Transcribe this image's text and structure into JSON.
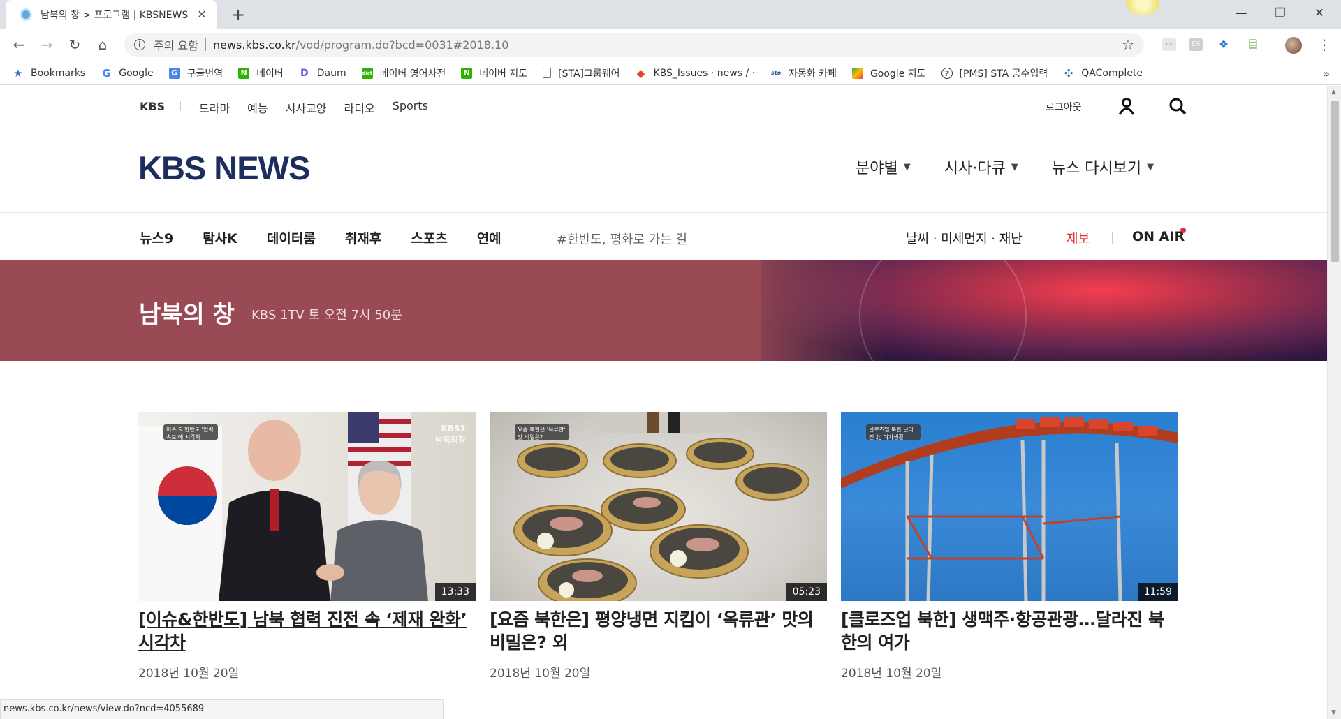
{
  "browser": {
    "tab_title": "남북의 창 > 프로그램 | KBSNEWS",
    "tab_close": "✕",
    "new_tab": "+",
    "window": {
      "minimize": "—",
      "restore": "❐",
      "close": "✕"
    },
    "security_label": "주의 요함",
    "url_host": "news.kbs.co.kr",
    "url_path": "/vod/program.do?bcd=0031#2018.10",
    "bookmarks": [
      {
        "label": "Bookmarks",
        "icon": "star-icon"
      },
      {
        "label": "Google",
        "icon": "google-icon"
      },
      {
        "label": "구글번역",
        "icon": "translate-icon"
      },
      {
        "label": "네이버",
        "icon": "naver-icon"
      },
      {
        "label": "Daum",
        "icon": "daum-icon"
      },
      {
        "label": "네이버 영어사전",
        "icon": "naver-dic-icon"
      },
      {
        "label": "네이버 지도",
        "icon": "naver-map-icon"
      },
      {
        "label": "[STA]그룹웨어",
        "icon": "page-icon"
      },
      {
        "label": "KBS_Issues · news / ·",
        "icon": "gitlab-icon"
      },
      {
        "label": "자동화 카페",
        "icon": "sto-icon"
      },
      {
        "label": "Google 지도",
        "icon": "maps-icon"
      },
      {
        "label": "[PMS] STA 공수입력",
        "icon": "pms-icon"
      },
      {
        "label": "QAComplete",
        "icon": "qa-icon"
      }
    ],
    "bookmarks_more": "»",
    "status_url": "news.kbs.co.kr/news/view.do?ncd=4055689"
  },
  "util": {
    "kbs": "KBS",
    "links": [
      "드라마",
      "예능",
      "시사교양",
      "라디오",
      "Sports"
    ],
    "logout": "로그아웃"
  },
  "header": {
    "logo": "KBS NEWS",
    "menu": [
      "분야별",
      "시사·다큐",
      "뉴스 다시보기"
    ]
  },
  "subnav": {
    "links": [
      "뉴스9",
      "탐사K",
      "데이터룸",
      "취재후",
      "스포츠",
      "연예"
    ],
    "hashtag": "#한반도, 평화로 가는 길",
    "weather": "날씨 · 미세먼지 · 재난",
    "report": "제보",
    "onair": "ON AIR"
  },
  "program": {
    "title": "남북의 창",
    "schedule": "KBS 1TV 토 오전 7시 50분"
  },
  "cards": [
    {
      "title": "[이슈&한반도] 남북 협력 진전 속 ‘제재 완화’ 시각차",
      "date": "2018년 10월 20일",
      "duration": "13:33",
      "tag": "이슈 & 한반도 '협력 속도'에 시각차"
    },
    {
      "title": "[요즘 북한은] 평양냉면 지킴이 ‘옥류관’ 맛의 비밀은? 외",
      "date": "2018년 10월 20일",
      "duration": "05:23",
      "tag": "요즘 북한은 '옥류관' 맛 비밀은?"
    },
    {
      "title": "[클로즈업 북한] 생맥주·항공관광…달라진 북한의 여가",
      "date": "2018년 10월 20일",
      "duration": "11:59",
      "tag": "클로즈업 북한 달라진 北 여가생활"
    }
  ],
  "thumb_logo": "KBS1\n남북의창",
  "colors": {
    "banner": "#9a4a55",
    "logo": "#1d2e5e",
    "accent_red": "#e22d3b"
  }
}
